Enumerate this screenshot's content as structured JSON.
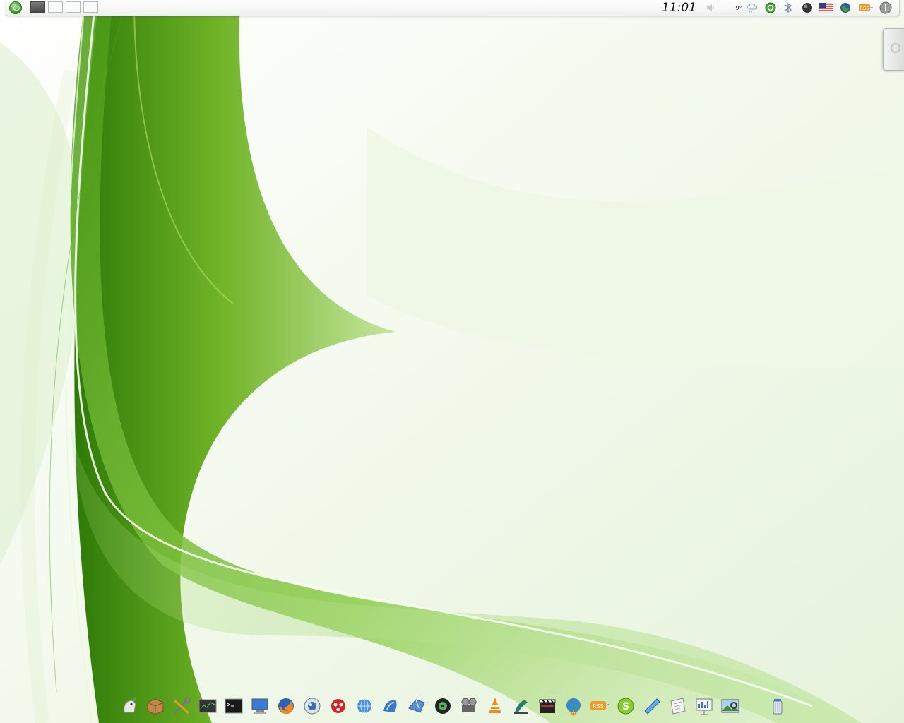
{
  "desktop": {
    "wallpaper_colors": [
      "#ffffff",
      "#e8f5dc",
      "#8cc63f",
      "#3f8f12",
      "#1e5c05"
    ]
  },
  "top_panel": {
    "launcher_icon": "app-launcher-icon",
    "pager_desktops": 4,
    "active_desktop": 1,
    "clock": "11:01",
    "weather_temp": "9°",
    "tray_icons": [
      "volume-icon",
      "weather-icon",
      "update-manager-icon",
      "bluetooth-icon",
      "network-icon",
      "keyboard-layout-us-icon",
      "globe-icon",
      "rss-feed-icon",
      "info-icon"
    ]
  },
  "dock": {
    "items": [
      {
        "name": "file-manager-icon",
        "interactable": true
      },
      {
        "name": "package-manager-icon",
        "interactable": true
      },
      {
        "name": "system-tools-icon",
        "interactable": true
      },
      {
        "name": "system-monitor-icon",
        "interactable": true
      },
      {
        "name": "terminal-icon",
        "interactable": true
      },
      {
        "name": "computer-icon",
        "interactable": true
      },
      {
        "name": "firefox-icon",
        "interactable": true
      },
      {
        "name": "browser-icon",
        "interactable": true
      },
      {
        "name": "chat-messenger-icon",
        "interactable": true
      },
      {
        "name": "network-globe-icon",
        "interactable": true
      },
      {
        "name": "internet-icon",
        "interactable": true
      },
      {
        "name": "bird-mail-icon",
        "interactable": true
      },
      {
        "name": "media-player-icon",
        "interactable": true
      },
      {
        "name": "video-projector-icon",
        "interactable": true
      },
      {
        "name": "vlc-icon",
        "interactable": true
      },
      {
        "name": "audio-editor-icon",
        "interactable": true
      },
      {
        "name": "clapperboard-icon",
        "interactable": true
      },
      {
        "name": "web-download-icon",
        "interactable": true
      },
      {
        "name": "rss-reader-icon",
        "interactable": true
      },
      {
        "name": "skype-icon",
        "interactable": true
      },
      {
        "name": "messenger-icon",
        "interactable": true
      },
      {
        "name": "text-editor-icon",
        "interactable": true
      },
      {
        "name": "presentation-icon",
        "interactable": true
      },
      {
        "name": "image-viewer-icon",
        "interactable": true
      },
      {
        "name": "trash-icon",
        "interactable": true
      }
    ]
  }
}
